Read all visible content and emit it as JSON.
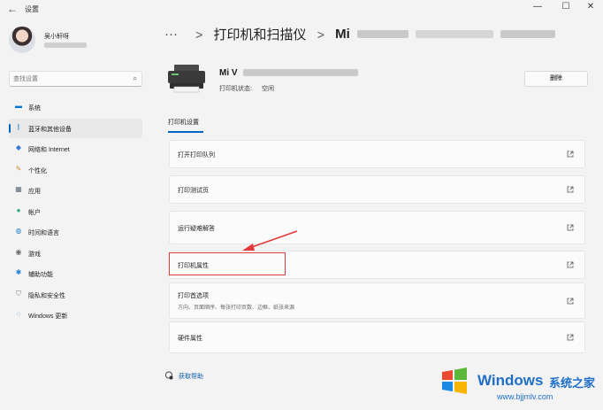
{
  "window": {
    "back_glyph": "←",
    "title": "设置",
    "controls": {
      "minimize": "—",
      "maximize": "☐",
      "close": "✕"
    }
  },
  "profile": {
    "name": "吴小轩呀"
  },
  "search": {
    "placeholder": "查找设置",
    "icon": "search-icon"
  },
  "sidebar": {
    "items": [
      {
        "label": "系统",
        "icon": "monitor-icon",
        "color": "#0078d4"
      },
      {
        "label": "蓝牙和其他设备",
        "icon": "bluetooth-icon",
        "color": "#0067c0",
        "active": true
      },
      {
        "label": "网络和 Internet",
        "icon": "wifi-icon",
        "color": "#3a7bd5"
      },
      {
        "label": "个性化",
        "icon": "brush-icon",
        "color": "#d08a3a"
      },
      {
        "label": "应用",
        "icon": "apps-icon",
        "color": "#5a6a7a"
      },
      {
        "label": "帐户",
        "icon": "person-icon",
        "color": "#2aa876"
      },
      {
        "label": "时间和语言",
        "icon": "globe-icon",
        "color": "#2e86c1"
      },
      {
        "label": "游戏",
        "icon": "game-icon",
        "color": "#6b6b6b"
      },
      {
        "label": "辅助功能",
        "icon": "accessibility-icon",
        "color": "#1f7fd1"
      },
      {
        "label": "隐私和安全性",
        "icon": "shield-icon",
        "color": "#7a7a7a"
      },
      {
        "label": "Windows 更新",
        "icon": "update-icon",
        "color": "#0a72c9"
      }
    ]
  },
  "breadcrumb": {
    "ellipsis": "···",
    "separator": ">",
    "parent": "打印机和扫描仪",
    "current": "Mi"
  },
  "printer": {
    "name": "Mi V",
    "status_label": "打印机状态:",
    "status_value": "空闲",
    "delete_label": "删除"
  },
  "tabs": {
    "settings": "打印机设置"
  },
  "settings_cards": [
    {
      "title": "打开打印队列",
      "subtitle": ""
    },
    {
      "title": "打印测试页",
      "subtitle": ""
    },
    {
      "title": "运行疑难解答",
      "subtitle": ""
    },
    {
      "title": "打印机属性",
      "subtitle": ""
    },
    {
      "title": "打印首选项",
      "subtitle": "方向、页面顺序、每张打印页数、边框、纸张来源"
    },
    {
      "title": "硬件属性",
      "subtitle": ""
    }
  ],
  "help": {
    "label": "获取帮助"
  },
  "watermark": {
    "brand": "Windows",
    "cn": "系统之家",
    "url": "www.bjjmlv.com"
  },
  "colors": {
    "accent": "#0067c0",
    "highlight": "#e23a3a",
    "watermark": "#1f6fc7"
  }
}
